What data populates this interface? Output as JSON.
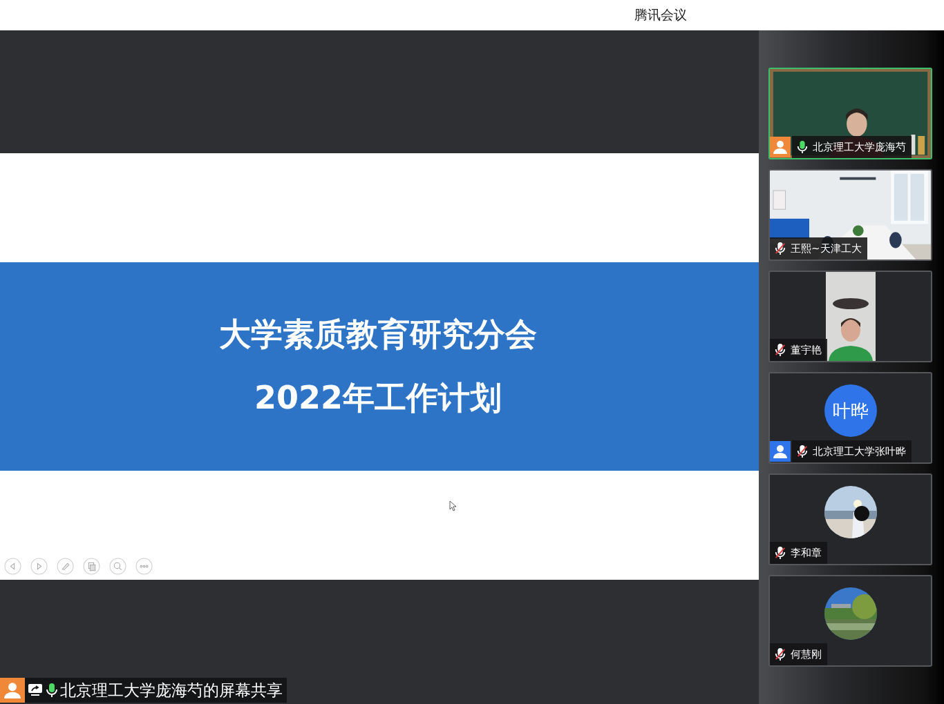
{
  "window": {
    "title": "腾讯会议"
  },
  "slide": {
    "title": "大学素质教育研究分会",
    "subtitle": "2022年工作计划",
    "toolbar": [
      {
        "kind": "prev"
      },
      {
        "kind": "next"
      },
      {
        "kind": "pen"
      },
      {
        "kind": "pages"
      },
      {
        "kind": "zoom"
      },
      {
        "kind": "more"
      }
    ]
  },
  "share_bar": {
    "badge": {
      "color": "#f0883a"
    },
    "muted": false,
    "label": "北京理工大学庞海芍的屏幕共享"
  },
  "participants": [
    {
      "name": "北京理工大学庞海芍",
      "badge": {
        "color": "#f0883a"
      },
      "muted": false,
      "speaking": true,
      "kind": "video"
    },
    {
      "name": "王熙~天津工大",
      "muted": true,
      "speaking": false,
      "kind": "video"
    },
    {
      "name": "董宇艳",
      "muted": true,
      "speaking": false,
      "kind": "portrait"
    },
    {
      "name": "北京理工大学张叶晔",
      "badge": {
        "color": "#2f74e8"
      },
      "muted": true,
      "speaking": false,
      "kind": "initials",
      "avatar_text": "叶晔"
    },
    {
      "name": "李和章",
      "muted": true,
      "speaking": false
    },
    {
      "name": "何慧刚",
      "muted": true,
      "speaking": false
    }
  ]
}
